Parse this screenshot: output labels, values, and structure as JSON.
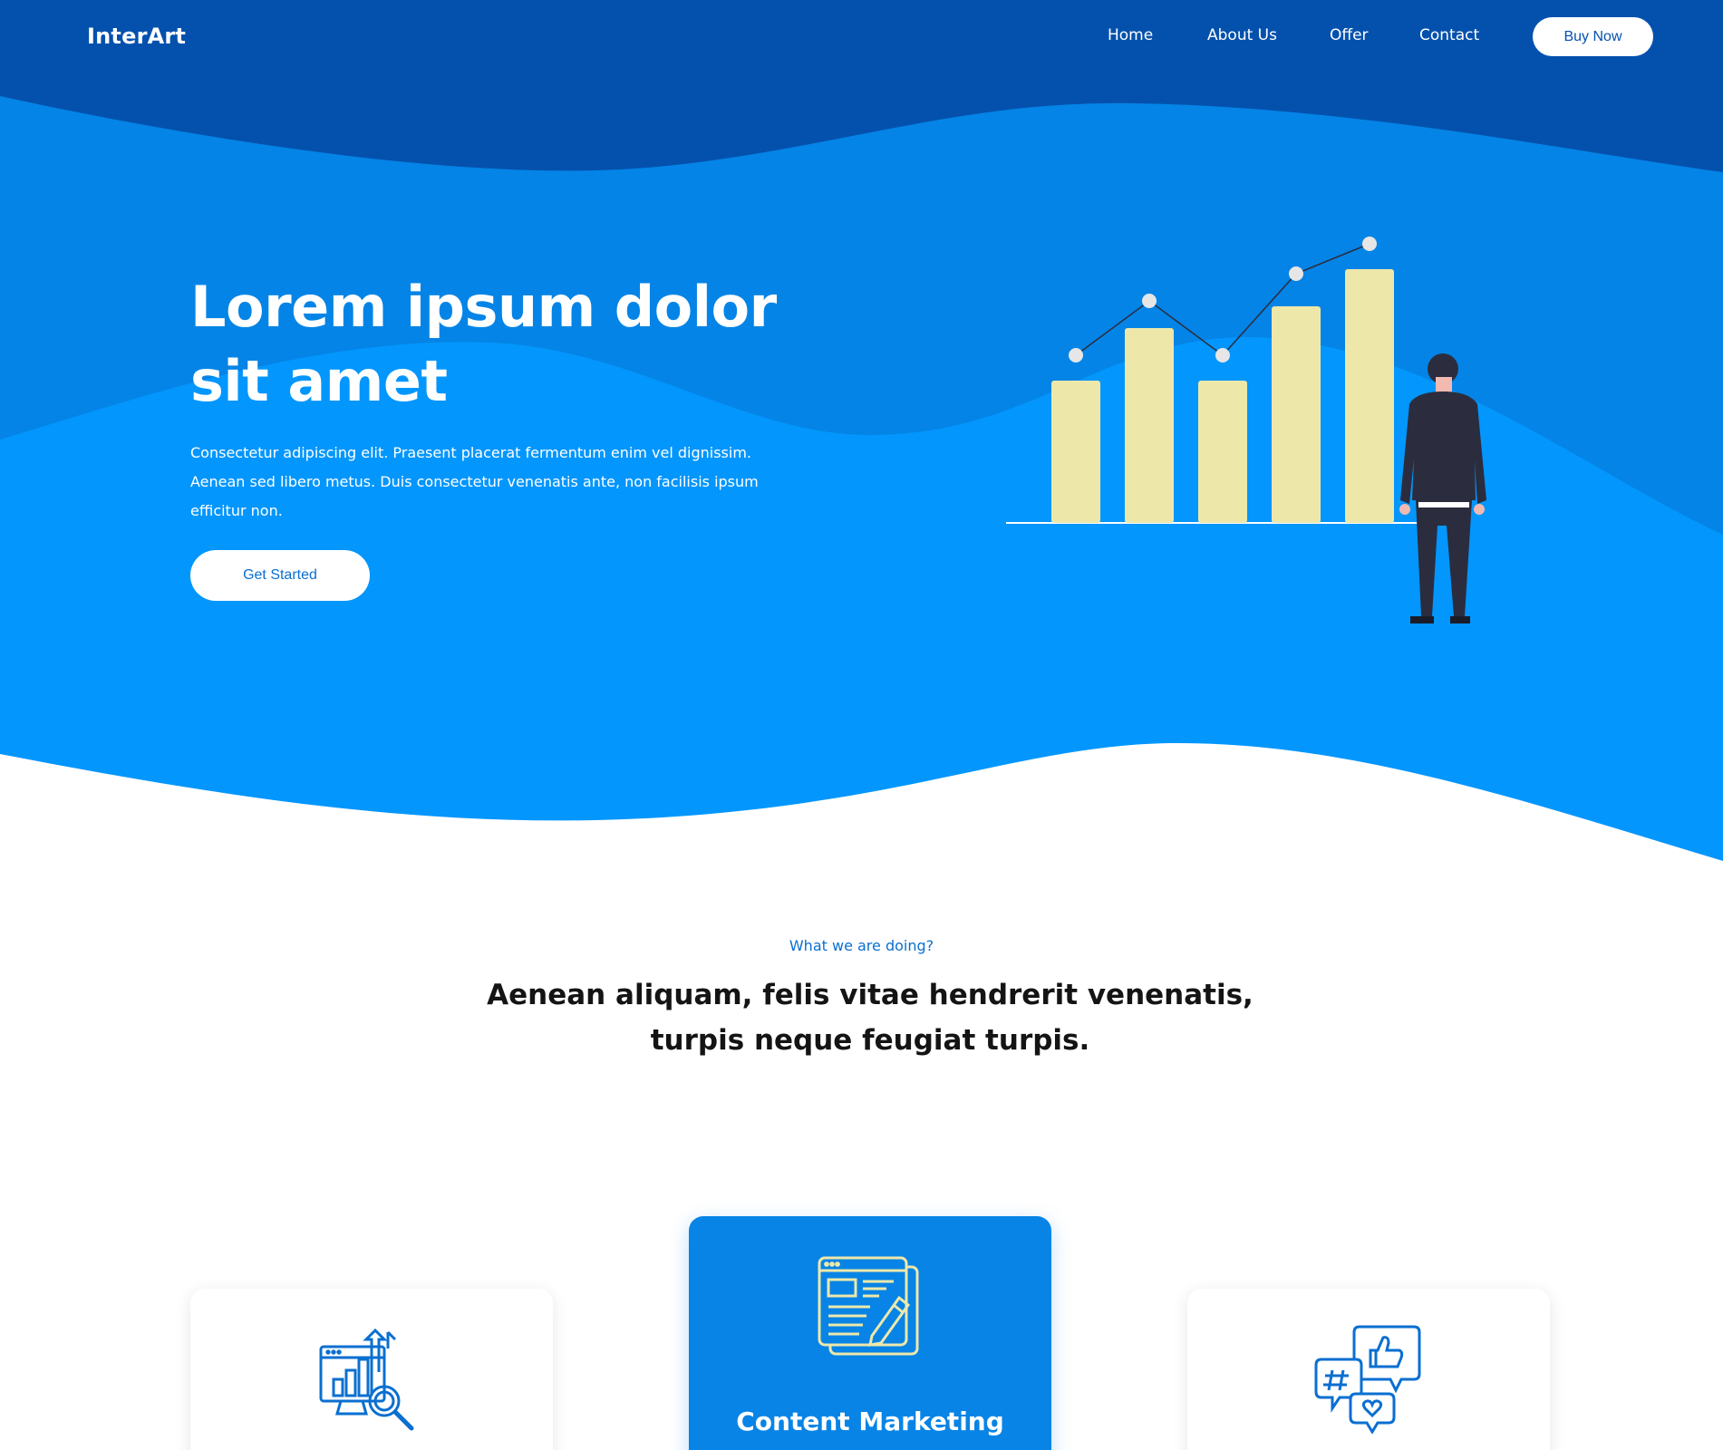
{
  "nav": {
    "brand": "InterArt",
    "links": [
      "Home",
      "About Us",
      "Offer",
      "Contact"
    ],
    "cta": "Buy Now"
  },
  "hero": {
    "title_line1": "Lorem ipsum dolor",
    "title_line2": "sit amet",
    "text": "Consectetur adipiscing elit. Praesent placerat fermentum enim vel dignissim. Aenean sed libero metus. Duis consectetur venenatis ante, non facilisis ipsum efficitur non.",
    "button": "Get Started"
  },
  "section": {
    "eyebrow": "What we are doing?",
    "title_line1": "Aenean aliquam, felis vitae hendrerit venenatis,",
    "title_line2": "turpis neque feugiat turpis."
  },
  "cards": [
    {
      "icon": "analytics-search-icon",
      "title": ""
    },
    {
      "icon": "content-marketing-icon",
      "title": "Content Marketing"
    },
    {
      "icon": "social-media-icon",
      "title": ""
    }
  ],
  "colors": {
    "nav_bg": "#0451ad",
    "hero_mid": "#0484e6",
    "hero_light": "#0396fd",
    "accent_yellow": "#ede8aa",
    "card_blue": "#0884e6",
    "icon_blue": "#0a6fd0",
    "text_dark": "#141414"
  }
}
